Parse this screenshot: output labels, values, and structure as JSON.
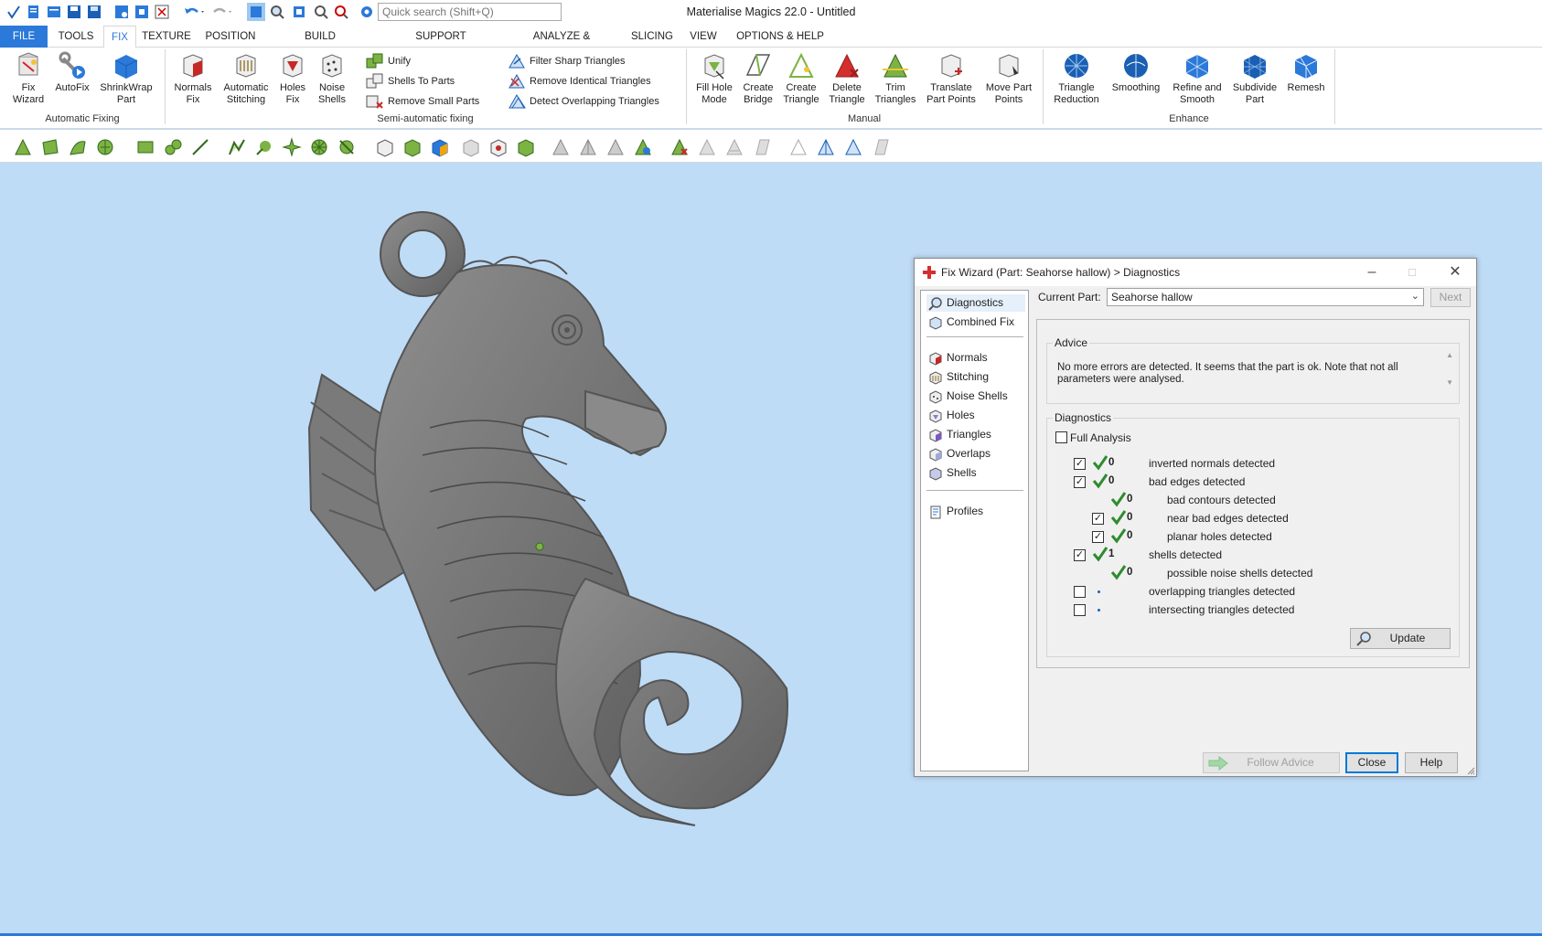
{
  "app": {
    "title": "Materialise Magics 22.0 - Untitled"
  },
  "quick_access": {
    "search_placeholder": "Quick search (Shift+Q)",
    "icons": [
      "app-icon",
      "new-icon",
      "open-icon",
      "save-icon",
      "save-as-icon",
      "import-icon",
      "export-icon",
      "close-part-icon",
      "undo-icon",
      "redo-icon",
      "select-icon",
      "zoom-part-icon",
      "view-icon",
      "zoom-icon",
      "zoom-out-icon",
      "settings-icon"
    ]
  },
  "tabs": [
    "FILE",
    "TOOLS",
    "FIX",
    "TEXTURE",
    "POSITION",
    "BUILD PREPARATION",
    "SUPPORT GENERATION",
    "ANALYZE & REPORT",
    "SLICING",
    "VIEW",
    "OPTIONS & HELP"
  ],
  "active_tab": "FIX",
  "ribbon": {
    "automatic_fixing": {
      "label": "Automatic Fixing",
      "fix_wizard": [
        "Fix",
        "Wizard"
      ],
      "autofix": "AutoFix",
      "shrinkwrap": [
        "ShrinkWrap",
        "Part"
      ]
    },
    "semi_automatic": {
      "label": "Semi-automatic fixing",
      "normals_fix": [
        "Normals",
        "Fix"
      ],
      "auto_stitching": [
        "Automatic",
        "Stitching"
      ],
      "holes_fix": [
        "Holes",
        "Fix"
      ],
      "noise_shells": [
        "Noise",
        "Shells"
      ],
      "unify": "Unify",
      "shells_to_parts": "Shells To Parts",
      "remove_small_parts": "Remove Small Parts",
      "filter_sharp": "Filter Sharp Triangles",
      "remove_identical": "Remove Identical Triangles",
      "detect_overlapping": "Detect Overlapping Triangles"
    },
    "manual": {
      "label": "Manual",
      "fill_hole_mode": [
        "Fill Hole",
        "Mode"
      ],
      "create_bridge": [
        "Create",
        "Bridge"
      ],
      "create_triangle": [
        "Create",
        "Triangle"
      ],
      "delete_triangle": [
        "Delete",
        "Triangle"
      ],
      "trim_triangles": [
        "Trim",
        "Triangles"
      ],
      "translate_part_points": [
        "Translate",
        "Part Points"
      ],
      "move_part_points": [
        "Move Part",
        "Points"
      ]
    },
    "enhance": {
      "label": "Enhance",
      "triangle_reduction": [
        "Triangle",
        "Reduction"
      ],
      "smoothing": "Smoothing",
      "refine_smooth": [
        "Refine and",
        "Smooth"
      ],
      "subdivide_part": [
        "Subdivide",
        "Part"
      ],
      "remesh": "Remesh"
    }
  },
  "dialog": {
    "title": "Fix Wizard (Part: Seahorse hallow) > Diagnostics",
    "nav": {
      "diagnostics": "Diagnostics",
      "combined_fix": "Combined Fix",
      "normals": "Normals",
      "stitching": "Stitching",
      "noise_shells": "Noise Shells",
      "holes": "Holes",
      "triangles": "Triangles",
      "overlaps": "Overlaps",
      "shells": "Shells",
      "profiles": "Profiles"
    },
    "current_part_label": "Current Part:",
    "current_part_value": "Seahorse hallow",
    "next_label": "Next",
    "advice_legend": "Advice",
    "advice_text": "No more errors are detected. It seems that the part is ok. Note that not all parameters were analysed.",
    "diagnostics_legend": "Diagnostics",
    "full_analysis_label": "Full Analysis",
    "rows": {
      "inverted_normals": {
        "count": "0",
        "label": "inverted normals detected"
      },
      "bad_edges": {
        "count": "0",
        "label": "bad edges detected"
      },
      "bad_contours": {
        "count": "0",
        "label": "bad contours detected"
      },
      "near_bad_edges": {
        "count": "0",
        "label": "near bad edges detected"
      },
      "planar_holes": {
        "count": "0",
        "label": "planar holes detected"
      },
      "shells": {
        "count": "1",
        "label": "shells detected"
      },
      "noise_shells": {
        "count": "0",
        "label": "possible noise shells detected"
      },
      "overlapping": {
        "label": "overlapping triangles detected"
      },
      "intersecting": {
        "label": "intersecting triangles detected"
      }
    },
    "update_label": "Update",
    "follow_advice_label": "Follow Advice",
    "close_label": "Close",
    "help_label": "Help"
  },
  "colors": {
    "accent": "#2b79d9",
    "viewport_bg": "#bfdcf7",
    "model_gray": "#7b7b7b",
    "check_green": "#2e8b2e"
  }
}
